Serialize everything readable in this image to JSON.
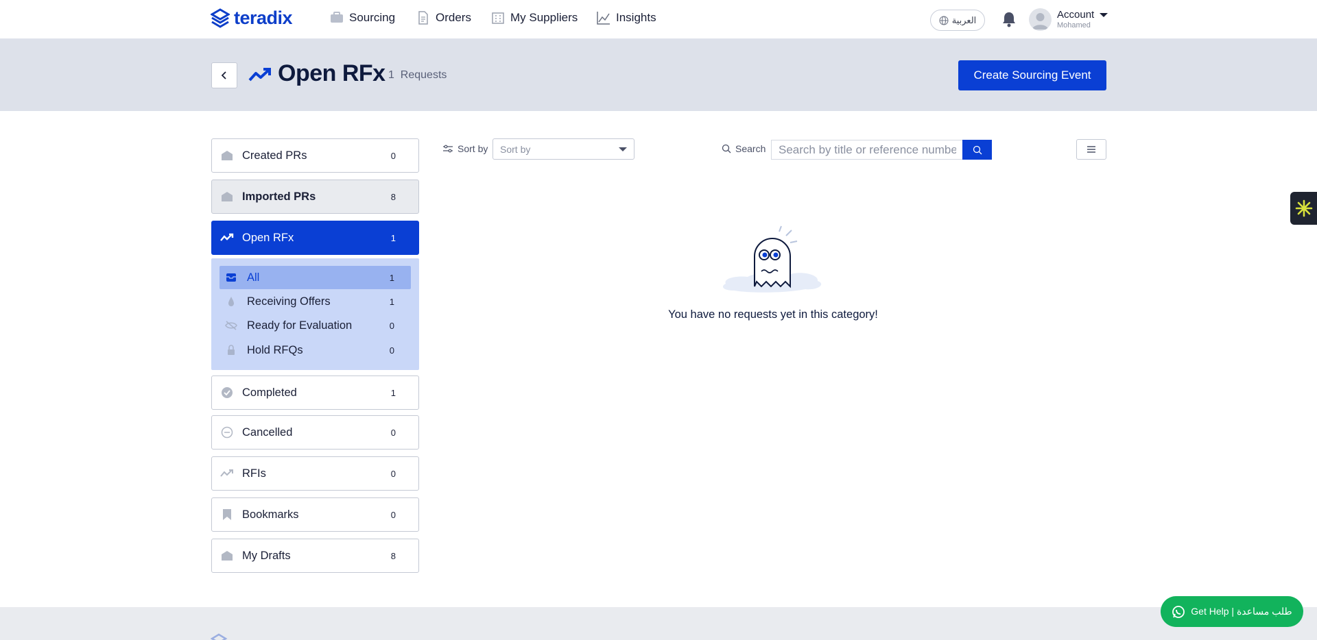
{
  "nav": {
    "logo": "teradix",
    "items": [
      {
        "label": "Sourcing",
        "icon": "briefcase-icon"
      },
      {
        "label": "Orders",
        "icon": "document-icon"
      },
      {
        "label": "My Suppliers",
        "icon": "building-icon"
      },
      {
        "label": "Insights",
        "icon": "chart-line-icon"
      }
    ],
    "language": "العربية",
    "account": {
      "label": "Account",
      "user": "Mohamed"
    }
  },
  "header": {
    "title": "Open RFx",
    "count": "1",
    "count_label": "Requests",
    "create_button": "Create Sourcing Event"
  },
  "sidebar": {
    "items": [
      {
        "label": "Created PRs",
        "count": "0",
        "icon": "inbox-icon"
      },
      {
        "label": "Imported PRs",
        "count": "8",
        "icon": "inbox-icon"
      },
      {
        "label": "Open RFx",
        "count": "1",
        "icon": "trend-icon"
      },
      {
        "label": "Completed",
        "count": "1",
        "icon": "check-circle-icon"
      },
      {
        "label": "Cancelled",
        "count": "0",
        "icon": "minus-circle-icon"
      },
      {
        "label": "RFIs",
        "count": "0",
        "icon": "trend-icon"
      },
      {
        "label": "Bookmarks",
        "count": "0",
        "icon": "bookmark-icon"
      },
      {
        "label": "My Drafts",
        "count": "8",
        "icon": "inbox-icon"
      }
    ],
    "sub_items": [
      {
        "label": "All",
        "count": "1",
        "icon": "tray-icon"
      },
      {
        "label": "Receiving Offers",
        "count": "1",
        "icon": "drop-icon"
      },
      {
        "label": "Ready for Evaluation",
        "count": "0",
        "icon": "eye-off-icon"
      },
      {
        "label": "Hold RFQs",
        "count": "0",
        "icon": "lock-icon"
      }
    ]
  },
  "toolbar": {
    "sort_label": "Sort by",
    "sort_value": "Sort by",
    "search_label": "Search",
    "search_placeholder": "Search by title or reference number"
  },
  "empty": {
    "message": "You have no requests yet in this category!"
  },
  "help": {
    "label": "Get Help | طلب مساعدة"
  },
  "colors": {
    "primary": "#0a3fd4",
    "band": "#dde1ea",
    "help": "#12b35c"
  }
}
